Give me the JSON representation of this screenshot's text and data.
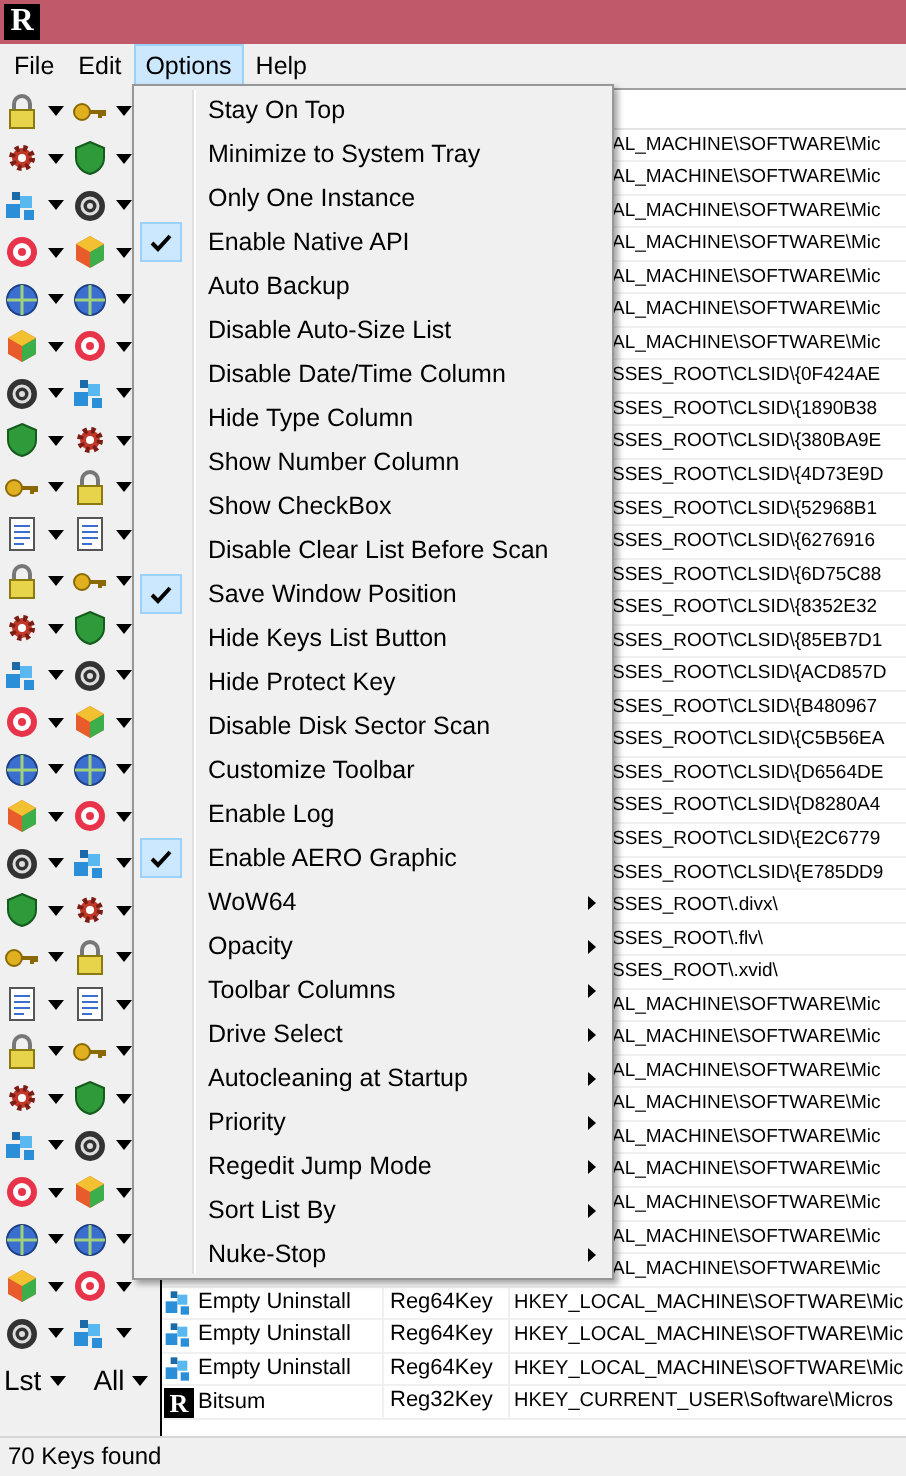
{
  "window": {
    "app_icon_letter": "R"
  },
  "menu_bar": [
    {
      "label": "File",
      "selected": false
    },
    {
      "label": "Edit",
      "selected": false
    },
    {
      "label": "Options",
      "selected": true
    },
    {
      "label": "Help",
      "selected": false
    }
  ],
  "toolbar": {
    "labels": [
      "Lst",
      "All"
    ]
  },
  "options_menu": [
    {
      "label": "Stay On Top",
      "checked": false,
      "submenu": false
    },
    {
      "label": "Minimize to System Tray",
      "checked": false,
      "submenu": false
    },
    {
      "label": "Only One Instance",
      "checked": false,
      "submenu": false
    },
    {
      "label": "Enable Native API",
      "checked": true,
      "submenu": false
    },
    {
      "label": "Auto Backup",
      "checked": false,
      "submenu": false
    },
    {
      "label": "Disable Auto-Size List",
      "checked": false,
      "submenu": false
    },
    {
      "label": "Disable Date/Time Column",
      "checked": false,
      "submenu": false
    },
    {
      "label": "Hide Type Column",
      "checked": false,
      "submenu": false
    },
    {
      "label": "Show Number Column",
      "checked": false,
      "submenu": false
    },
    {
      "label": "Show CheckBox",
      "checked": false,
      "submenu": false
    },
    {
      "label": "Disable Clear List Before Scan",
      "checked": false,
      "submenu": false
    },
    {
      "label": "Save Window Position",
      "checked": true,
      "submenu": false
    },
    {
      "label": "Hide Keys List Button",
      "checked": false,
      "submenu": false
    },
    {
      "label": "Hide Protect Key",
      "checked": false,
      "submenu": false
    },
    {
      "label": "Disable Disk Sector Scan",
      "checked": false,
      "submenu": false
    },
    {
      "label": "Customize Toolbar",
      "checked": false,
      "submenu": false
    },
    {
      "label": "Enable Log",
      "checked": false,
      "submenu": false
    },
    {
      "label": "Enable AERO Graphic",
      "checked": true,
      "submenu": false
    },
    {
      "label": "WoW64",
      "checked": false,
      "submenu": true
    },
    {
      "label": "Opacity",
      "checked": false,
      "submenu": true
    },
    {
      "label": "Toolbar Columns",
      "checked": false,
      "submenu": true
    },
    {
      "label": "Drive Select",
      "checked": false,
      "submenu": true
    },
    {
      "label": "Autocleaning at Startup",
      "checked": false,
      "submenu": true
    },
    {
      "label": "Priority",
      "checked": false,
      "submenu": true
    },
    {
      "label": "Regedit Jump Mode",
      "checked": false,
      "submenu": true
    },
    {
      "label": "Sort List By",
      "checked": false,
      "submenu": true
    },
    {
      "label": "Nuke-Stop",
      "checked": false,
      "submenu": true
    }
  ],
  "list": {
    "rows": [
      {
        "kind": "covered",
        "path": "AL_MACHINE\\SOFTWARE\\Mic"
      },
      {
        "kind": "covered",
        "path": "AL_MACHINE\\SOFTWARE\\Mic"
      },
      {
        "kind": "covered",
        "path": "AL_MACHINE\\SOFTWARE\\Mic"
      },
      {
        "kind": "covered",
        "path": "AL_MACHINE\\SOFTWARE\\Mic"
      },
      {
        "kind": "covered",
        "path": "AL_MACHINE\\SOFTWARE\\Mic"
      },
      {
        "kind": "covered",
        "path": "AL_MACHINE\\SOFTWARE\\Mic"
      },
      {
        "kind": "covered",
        "path": "AL_MACHINE\\SOFTWARE\\Mic"
      },
      {
        "kind": "covered",
        "path": "SSES_ROOT\\CLSID\\{0F424AE"
      },
      {
        "kind": "covered",
        "path": "SSES_ROOT\\CLSID\\{1890B38"
      },
      {
        "kind": "covered",
        "path": "SSES_ROOT\\CLSID\\{380BA9E"
      },
      {
        "kind": "covered",
        "path": "SSES_ROOT\\CLSID\\{4D73E9D"
      },
      {
        "kind": "covered",
        "path": "SSES_ROOT\\CLSID\\{52968B1"
      },
      {
        "kind": "covered",
        "path": "SSES_ROOT\\CLSID\\{6276916"
      },
      {
        "kind": "covered",
        "path": "SSES_ROOT\\CLSID\\{6D75C88"
      },
      {
        "kind": "covered",
        "path": "SSES_ROOT\\CLSID\\{8352E32"
      },
      {
        "kind": "covered",
        "path": "SSES_ROOT\\CLSID\\{85EB7D1"
      },
      {
        "kind": "covered",
        "path": "SSES_ROOT\\CLSID\\{ACD857D"
      },
      {
        "kind": "covered",
        "path": "SSES_ROOT\\CLSID\\{B480967"
      },
      {
        "kind": "covered",
        "path": "SSES_ROOT\\CLSID\\{C5B56EA"
      },
      {
        "kind": "covered",
        "path": "SSES_ROOT\\CLSID\\{D6564DE"
      },
      {
        "kind": "covered",
        "path": "SSES_ROOT\\CLSID\\{D8280A4"
      },
      {
        "kind": "covered",
        "path": "SSES_ROOT\\CLSID\\{E2C6779"
      },
      {
        "kind": "covered",
        "path": "SSES_ROOT\\CLSID\\{E785DD9"
      },
      {
        "kind": "covered",
        "path": "SSES_ROOT\\.divx\\"
      },
      {
        "kind": "covered",
        "path": "SSES_ROOT\\.flv\\"
      },
      {
        "kind": "covered",
        "path": "SSES_ROOT\\.xvid\\"
      },
      {
        "kind": "covered",
        "path": "AL_MACHINE\\SOFTWARE\\Mic"
      },
      {
        "kind": "covered",
        "path": "AL_MACHINE\\SOFTWARE\\Mic"
      },
      {
        "kind": "covered",
        "path": "AL_MACHINE\\SOFTWARE\\Mic"
      },
      {
        "kind": "covered",
        "path": "AL_MACHINE\\SOFTWARE\\Mic"
      },
      {
        "kind": "covered",
        "path": "AL_MACHINE\\SOFTWARE\\Mic"
      },
      {
        "kind": "covered",
        "path": "AL_MACHINE\\SOFTWARE\\Mic"
      },
      {
        "kind": "covered",
        "path": "AL_MACHINE\\SOFTWARE\\Mic"
      },
      {
        "kind": "covered",
        "path": "AL_MACHINE\\SOFTWARE\\Mic"
      },
      {
        "kind": "covered",
        "path": "AL_MACHINE\\SOFTWARE\\Mic"
      },
      {
        "kind": "entry",
        "name": "Empty Uninstall",
        "type": "Reg64Key",
        "path": "HKEY_LOCAL_MACHINE\\SOFTWARE\\Mic"
      },
      {
        "kind": "entry",
        "name": "Empty Uninstall",
        "type": "Reg64Key",
        "path": "HKEY_LOCAL_MACHINE\\SOFTWARE\\Mic"
      },
      {
        "kind": "entry",
        "name": "Empty Uninstall",
        "type": "Reg64Key",
        "path": "HKEY_LOCAL_MACHINE\\SOFTWARE\\Mic"
      },
      {
        "kind": "entry",
        "name": "Bitsum",
        "type": "Reg32Key",
        "path": "HKEY_CURRENT_USER\\Software\\Micros",
        "icon_letter": "R"
      }
    ]
  },
  "status_bar": "70 Keys found"
}
